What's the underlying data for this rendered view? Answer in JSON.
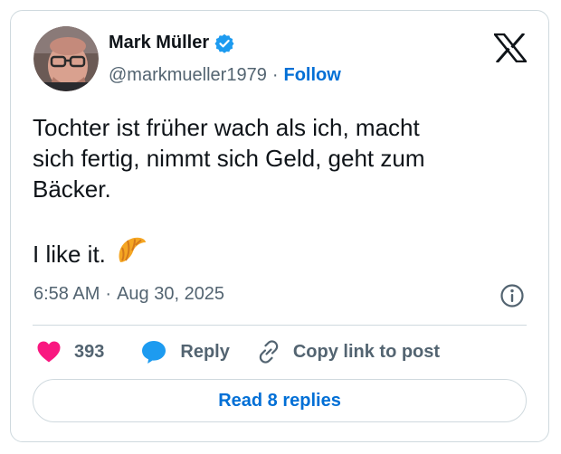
{
  "author": {
    "name": "Mark Müller",
    "handle": "@markmueller1979",
    "separator": "·",
    "follow_label": "Follow"
  },
  "tweet": {
    "line1": "Tochter ist früher wach als ich, macht",
    "line2": "sich fertig, nimmt sich Geld, geht zum",
    "line3": "Bäcker.",
    "line4": "I like it.",
    "emoji_icon": "croissant-icon"
  },
  "meta": {
    "time": "6:58 AM",
    "separator": "·",
    "date": "Aug 30, 2025"
  },
  "actions": {
    "likes_count": "393",
    "reply_label": "Reply",
    "copy_label": "Copy link to post"
  },
  "read_replies_label": "Read 8 replies",
  "colors": {
    "accent": "#006fd6",
    "verified": "#1d9bf0",
    "like": "#f91880",
    "muted": "#536471",
    "border": "#cfd9de"
  }
}
